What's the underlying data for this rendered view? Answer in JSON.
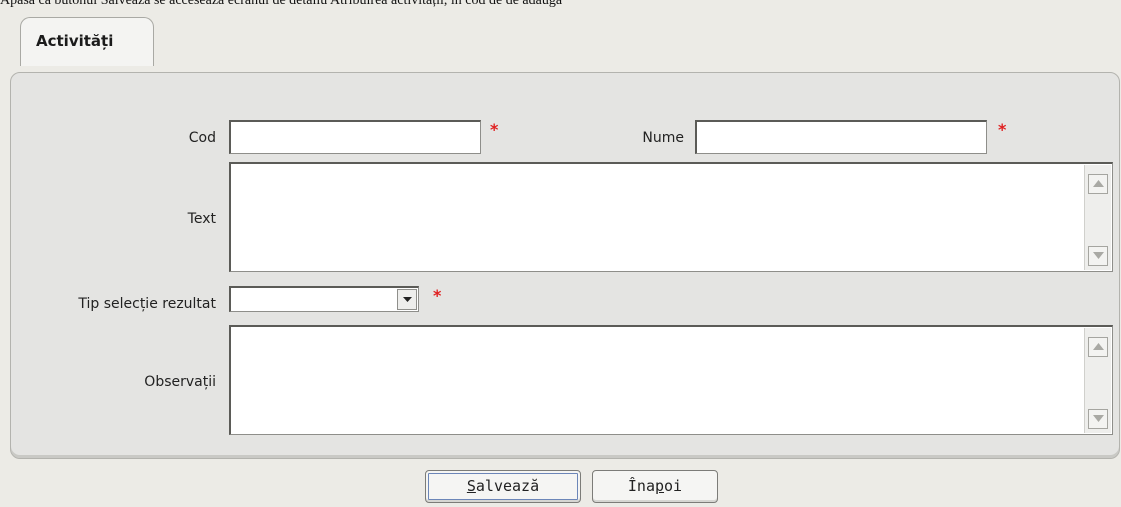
{
  "top_text": "Apăsă că butonul Salvează se accesează ecranul de detaliu Atribuirea activității, în cod de de adăuga",
  "tab": {
    "label": "Activități"
  },
  "form": {
    "cod": {
      "label": "Cod",
      "value": ""
    },
    "nume": {
      "label": "Nume",
      "value": ""
    },
    "text": {
      "label": "Text",
      "value": ""
    },
    "tip_selectie": {
      "label": "Tip selecție rezultat",
      "value": ""
    },
    "observatii": {
      "label": "Observații",
      "value": ""
    },
    "required_mark": "*"
  },
  "buttons": {
    "save": {
      "mnemonic": "S",
      "rest": "alvează"
    },
    "back": {
      "pre": "Îna",
      "mnemonic": "p",
      "post": "oi"
    }
  },
  "colors": {
    "required": "#e02020",
    "background": "#ecebe6",
    "panel": "#e4e4e2"
  }
}
